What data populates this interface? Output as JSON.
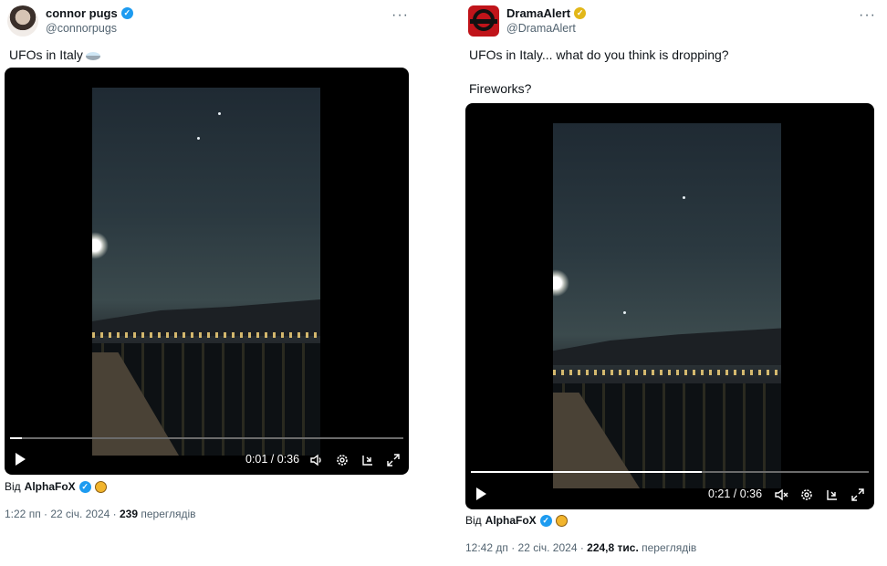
{
  "tweets": [
    {
      "name": "connor pugs",
      "handle": "@connorpugs",
      "more": "···",
      "text": "UFOs in Italy",
      "text_emoji_icon": "ufo-icon",
      "video": {
        "time": "0:01 / 0:36",
        "progress": 0.03
      },
      "from_prefix": "Від",
      "from_source": "AlphaFoX",
      "timestamp": "1:22 пп · 22 січ. 2024 · ",
      "views": "239",
      "views_label": " переглядів"
    },
    {
      "name": "DramaAlert",
      "handle": "@DramaAlert",
      "more": "···",
      "text": "UFOs in Italy... what do you think is dropping?",
      "text2": "Fireworks?",
      "video": {
        "time": "0:21 / 0:36",
        "progress": 0.58
      },
      "from_prefix": "Від",
      "from_source": "AlphaFoX",
      "timestamp": "12:42 дп · 22 січ. 2024 · ",
      "views": "224,8 тис.",
      "views_label": " переглядів"
    }
  ],
  "icons": {
    "verified": "verified-badge-icon",
    "gold_verified": "gold-verified-badge-icon",
    "play": "play-icon",
    "volume": "volume-icon",
    "muted": "muted-volume-icon",
    "settings": "gear-icon",
    "dock": "dock-video-icon",
    "fullscreen": "fullscreen-icon"
  },
  "colors": {
    "verified_blue": "#1d9bf0",
    "gold": "#e2b719",
    "muted_text": "#536471"
  }
}
